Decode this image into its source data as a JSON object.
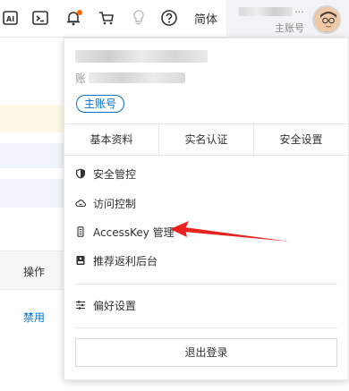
{
  "topbar": {
    "icons": [
      "ai-icon",
      "terminal-icon",
      "bell-icon",
      "cart-icon",
      "lightbulb-icon",
      "help-icon"
    ],
    "language_label": "简体",
    "account_more": "...",
    "account_role": "主账号"
  },
  "panel": {
    "account_prefix": "账",
    "role_badge": "主账号",
    "tabs": [
      "基本资料",
      "实名认证",
      "安全设置"
    ],
    "menu": [
      {
        "label": "安全管控",
        "icon": "shield-icon"
      },
      {
        "label": "访问控制",
        "icon": "cloud-icon"
      },
      {
        "label": "AccessKey 管理",
        "icon": "key-icon"
      },
      {
        "label": "推荐返利后台",
        "icon": "wallet-icon"
      }
    ],
    "preferences": {
      "label": "偏好设置",
      "icon": "sliders-icon"
    },
    "logout_label": "退出登录"
  },
  "background": {
    "column_header": "操作",
    "row_action": "禁用"
  },
  "colors": {
    "accent": "#0070cc",
    "notify_dot": "#ff6a00",
    "annotation_arrow": "#e8231f"
  }
}
